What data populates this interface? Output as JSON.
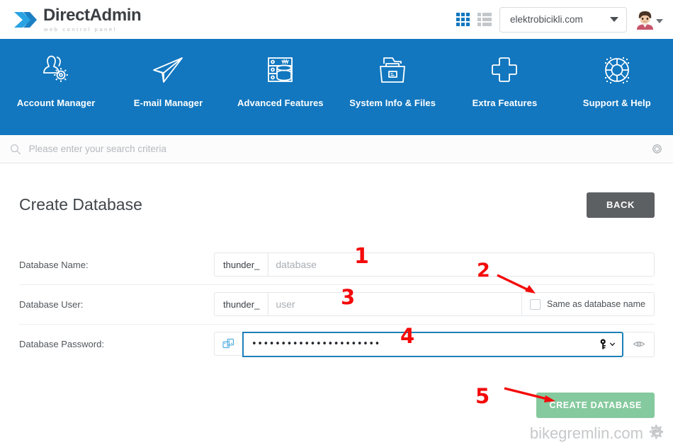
{
  "header": {
    "brand_name": "DirectAdmin",
    "brand_sub": "web control panel",
    "grid_icon": "grid-view-icon",
    "list_icon": "list-view-icon",
    "domain_selected": "elektrobicikli.com",
    "avatar_icon": "user-avatar-icon"
  },
  "nav": {
    "items": [
      {
        "label": "Account Manager",
        "icon": "users-gear-icon"
      },
      {
        "label": "E-mail Manager",
        "icon": "paper-plane-icon"
      },
      {
        "label": "Advanced Features",
        "icon": "server-database-icon"
      },
      {
        "label": "System Info & Files",
        "icon": "folder-files-icon"
      },
      {
        "label": "Extra Features",
        "icon": "plus-icon"
      },
      {
        "label": "Support & Help",
        "icon": "life-ring-icon"
      }
    ],
    "background_color": "#1277bf"
  },
  "search": {
    "placeholder": "Please enter your search criteria",
    "value": "",
    "search_icon": "search-icon",
    "settings_icon": "gear-icon"
  },
  "page": {
    "title": "Create Database",
    "back_label": "BACK"
  },
  "form": {
    "rows": [
      {
        "label": "Database Name:",
        "prefix": "thunder_",
        "placeholder": "database",
        "value": ""
      },
      {
        "label": "Database User:",
        "prefix": "thunder_",
        "placeholder": "user",
        "value": "",
        "checkbox_label": "Same as database name",
        "checkbox_checked": false
      },
      {
        "label": "Database Password:",
        "random_icon": "dice-random-icon",
        "value": "••••••••••••••••••••••",
        "key_icon": "key-icon",
        "chevron_icon": "chevron-down-icon",
        "reveal_icon": "eye-icon"
      }
    ],
    "submit_label": "CREATE DATABASE",
    "submit_color": "#85c99e"
  },
  "annotations": [
    {
      "number": "1"
    },
    {
      "number": "2"
    },
    {
      "number": "3"
    },
    {
      "number": "4"
    },
    {
      "number": "5"
    }
  ],
  "watermark": {
    "text": "bikegremlin.com",
    "logo_icon": "gear-g-logo-icon"
  }
}
